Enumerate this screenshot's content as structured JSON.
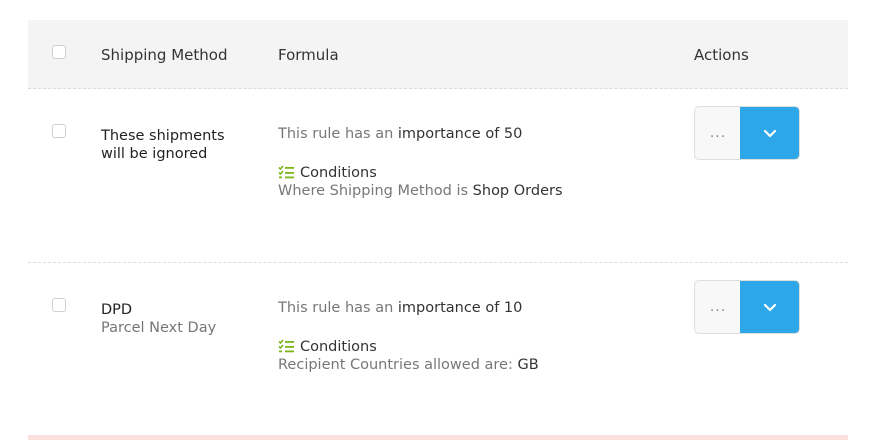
{
  "header": {
    "shipping_method": "Shipping Method",
    "formula": "Formula",
    "actions": "Actions"
  },
  "rows": [
    {
      "method_name": "These shipments will be ignored",
      "method_sub": "",
      "formula_prefix": "This rule has an ",
      "formula_strong": "importance of 50",
      "conditions_label": "Conditions",
      "condition_prefix": "Where Shipping Method is ",
      "condition_value": "Shop Orders",
      "action_more": "...",
      "icons": [
        "checklist-icon",
        "chevron-down-icon"
      ]
    },
    {
      "method_name": "DPD",
      "method_sub": "Parcel Next Day",
      "formula_prefix": "This rule has an ",
      "formula_strong": "importance of 10",
      "conditions_label": "Conditions",
      "condition_prefix": "Recipient Countries allowed are: ",
      "condition_value": "GB",
      "action_more": "...",
      "icons": [
        "checklist-icon",
        "chevron-down-icon"
      ]
    }
  ],
  "colors": {
    "accent": "#2ea7e8",
    "conditions_icon": "#7cb518"
  }
}
